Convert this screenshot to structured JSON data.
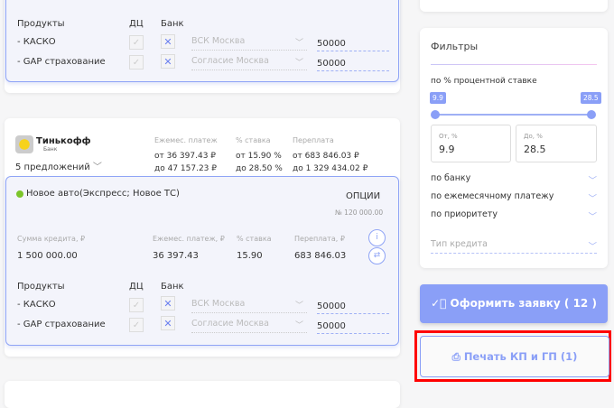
{
  "top_offer": {
    "products_header": "Продукты",
    "dc_header": "ДЦ",
    "bank_header": "Банк",
    "products": [
      {
        "name": "- КАСКО",
        "insurer": "ВСК Москва",
        "amount": "50000"
      },
      {
        "name": "- GAP страхование",
        "insurer": "Согласие Москва",
        "amount": "50000"
      }
    ]
  },
  "bank": {
    "name": "Тинькофф",
    "sub": "Банк",
    "offers_count": "5 предложений",
    "payment_label": "Ежемес. платеж",
    "payment_from": "от 36 397.43 ₽",
    "payment_to": "до 47 157.23 ₽",
    "rate_label": "% ставка",
    "rate_from": "от 15.90 %",
    "rate_to": "до 28.50 %",
    "overpay_label": "Переплата",
    "overpay_from": "от 683 846.03 ₽",
    "overpay_to": "до 1 329 434.02 ₽"
  },
  "offer": {
    "status_color": "#7cc52b",
    "title": "Новое авто(Экспресс; Новое ТС)",
    "options_label": "ОПЦИИ",
    "options_value": "№ 120 000.00",
    "sum_label": "Сумма кредита, ₽",
    "sum": "1 500 000.00",
    "payment_label": "Ежемес. платеж, ₽",
    "payment": "36 397.43",
    "rate_label": "% ставка",
    "rate": "15.90",
    "overpay_label": "Переплата, ₽",
    "overpay": "683 846.03",
    "products_header": "Продукты",
    "dc_header": "ДЦ",
    "bank_header": "Банк",
    "products": [
      {
        "name": "- КАСКО",
        "insurer": "ВСК Москва",
        "amount": "50000"
      },
      {
        "name": "- GAP страхование",
        "insurer": "Согласие Москва",
        "amount": "50000"
      }
    ]
  },
  "filters": {
    "title": "Фильтры",
    "rate_label": "по % процентной ставке",
    "min_badge": "9.9",
    "max_badge": "28.5",
    "from_label": "От, %",
    "from_value": "9.9",
    "to_label": "До, %",
    "to_value": "28.5",
    "by_bank": "по банку",
    "by_payment": "по ежемесячному платежу",
    "by_priority": "по приоритету",
    "credit_type_placeholder": "Тип кредита"
  },
  "actions": {
    "apply": "Оформить заявку ( 12 )",
    "print": "Печать КП и ГП (1)"
  },
  "colors": {
    "accent": "#8a9ff7",
    "highlight": "#ff0000"
  }
}
